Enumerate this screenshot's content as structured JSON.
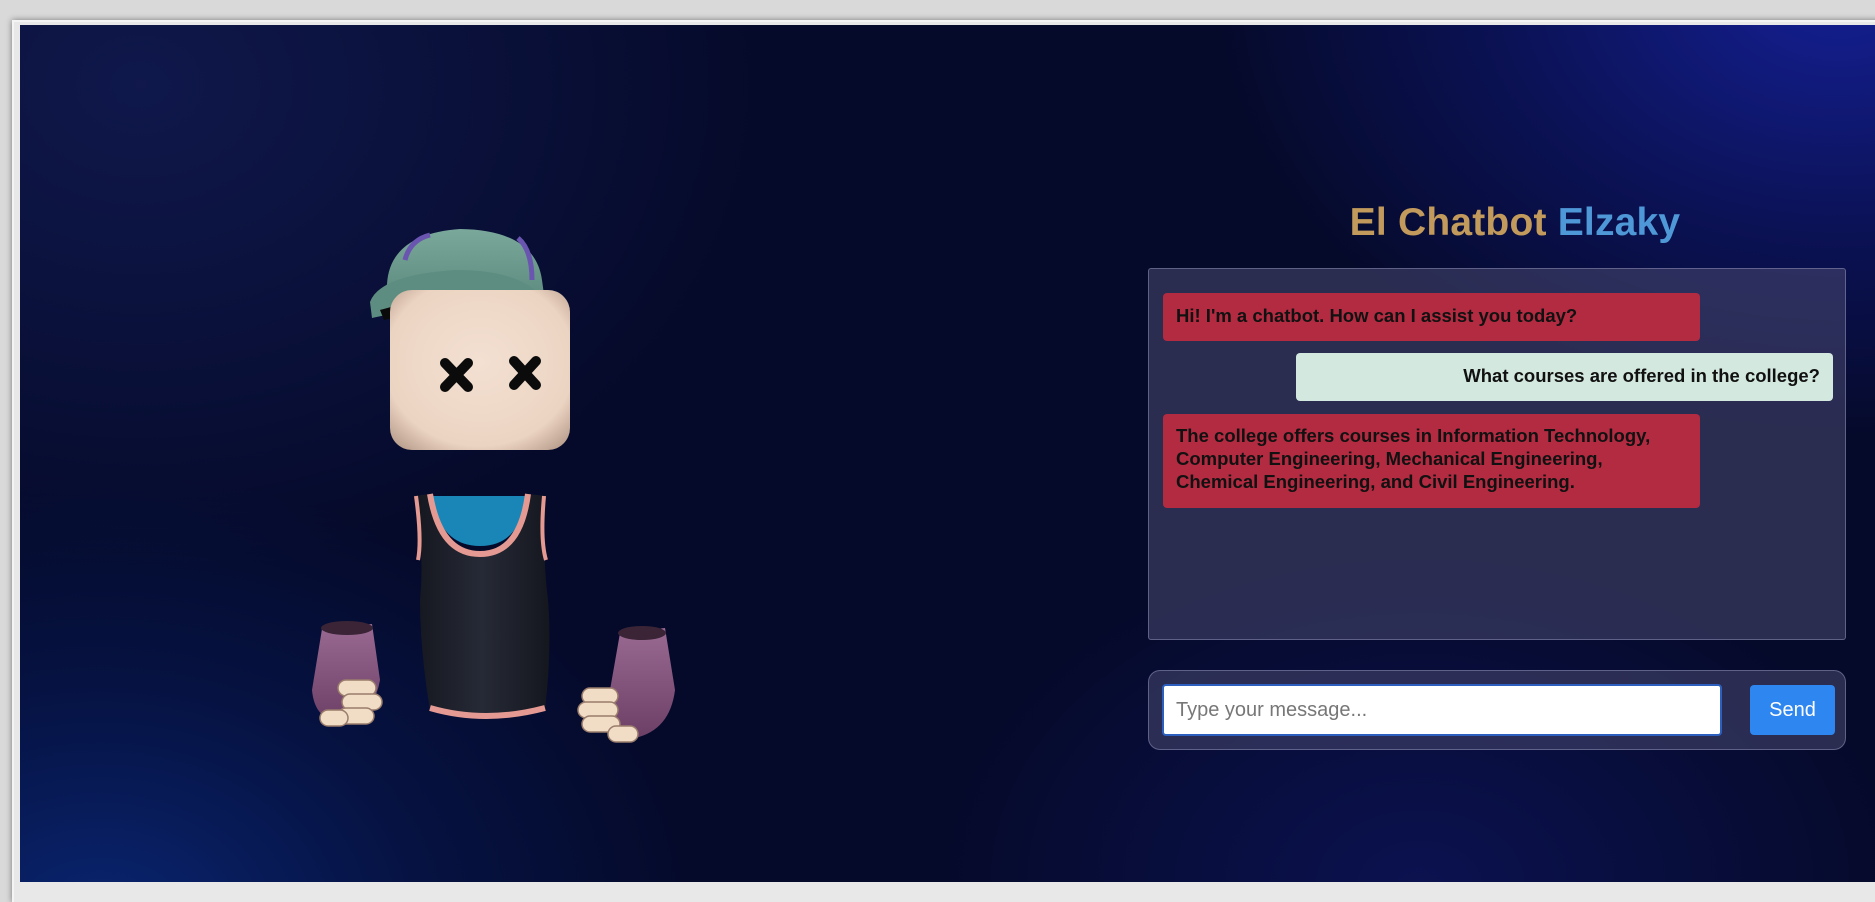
{
  "header": {
    "title_part1": "El Chatbot",
    "title_part2": "Elzaky"
  },
  "colors": {
    "title_part1": "#c29a5c",
    "title_part2": "#4f98d8",
    "bot_bubble": "#b22b41",
    "user_bubble": "#d3e8df",
    "send_button": "#2e86f0"
  },
  "chat": {
    "messages": [
      {
        "sender": "bot",
        "text": "Hi! I'm a chatbot. How can I assist you today?"
      },
      {
        "sender": "user",
        "text": "What courses are offered in the college?"
      },
      {
        "sender": "bot",
        "text": "The college offers courses in Information Technology, Computer Engineering, Mechanical Engineering, Chemical Engineering, and Civil Engineering."
      }
    ]
  },
  "composer": {
    "placeholder": "Type your message...",
    "value": "",
    "send_label": "Send"
  },
  "avatar": {
    "icon": "3d-avatar-character"
  }
}
